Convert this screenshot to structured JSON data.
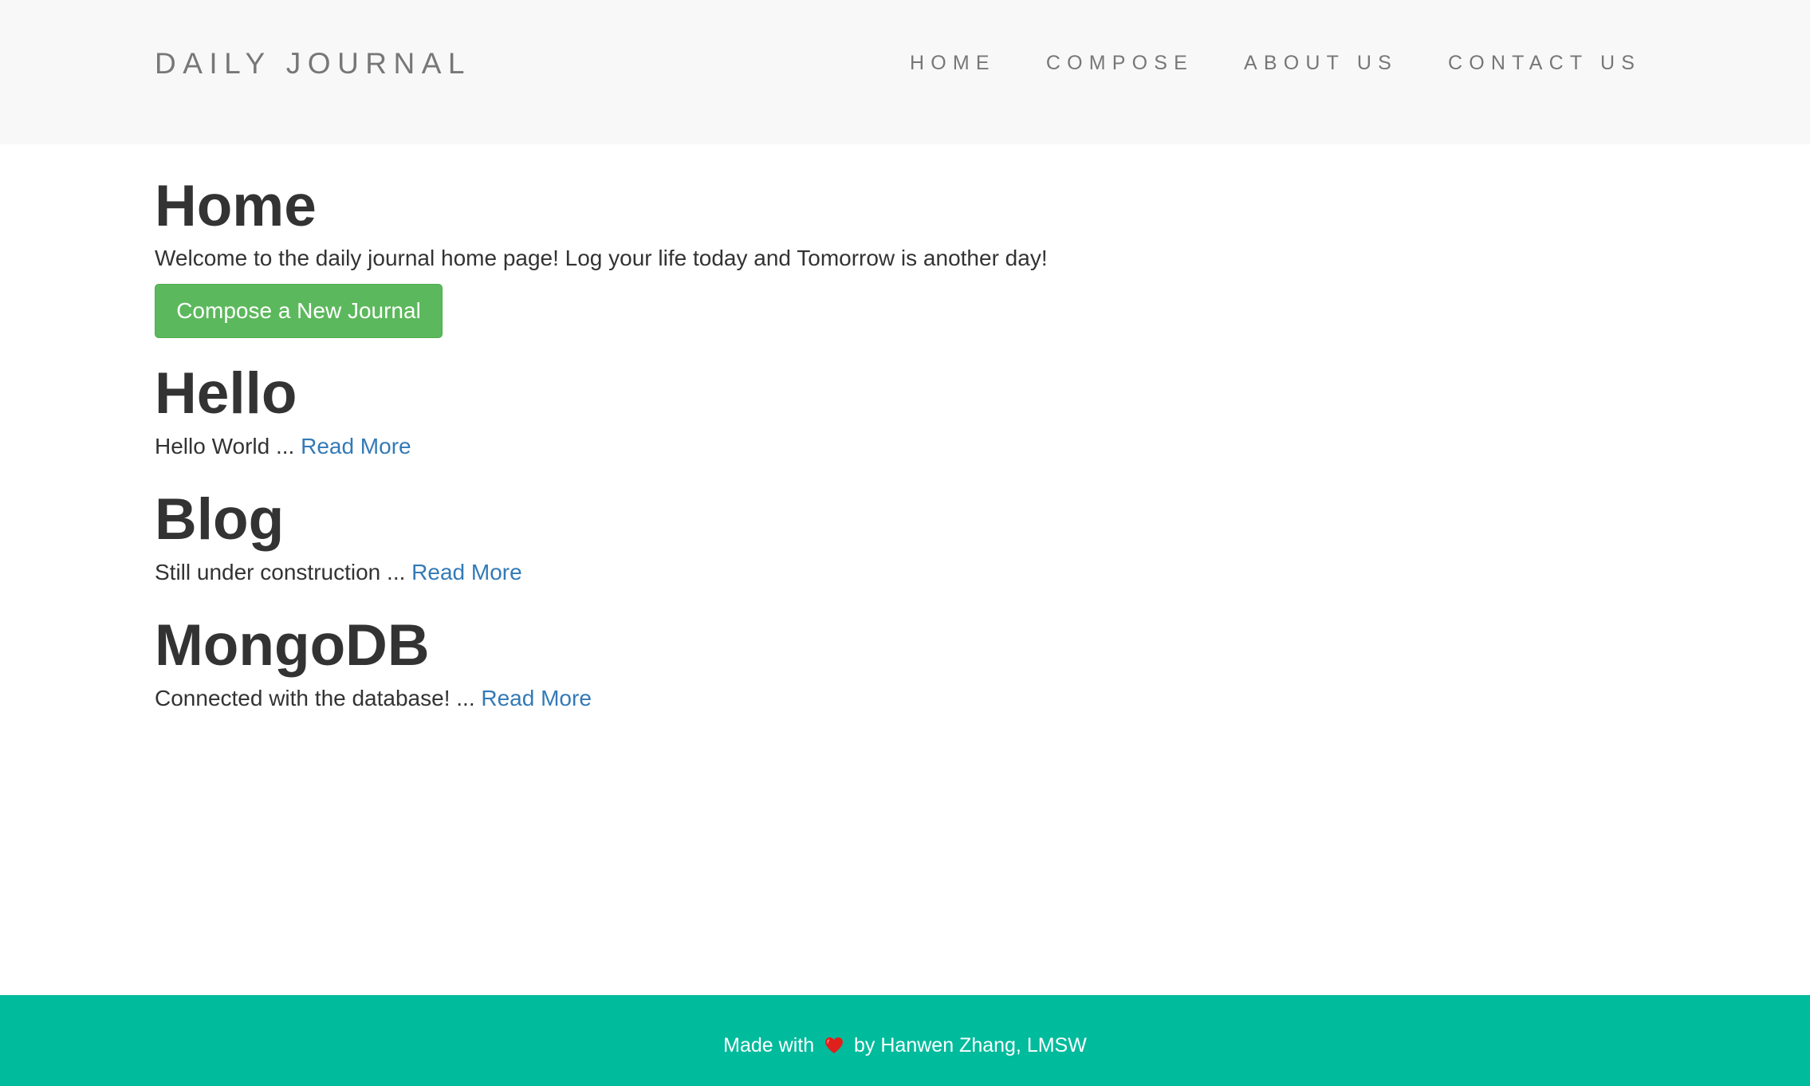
{
  "header": {
    "brand": "DAILY JOURNAL",
    "nav": [
      {
        "label": "HOME"
      },
      {
        "label": "COMPOSE"
      },
      {
        "label": "ABOUT US"
      },
      {
        "label": "CONTACT US"
      }
    ]
  },
  "main": {
    "title": "Home",
    "intro": "Welcome to the daily journal home page! Log your life today and Tomorrow is another day!",
    "compose_button": "Compose a New Journal",
    "posts": [
      {
        "title": "Hello",
        "excerpt": "Hello World ... ",
        "link": "Read More"
      },
      {
        "title": "Blog",
        "excerpt": "Still under construction ... ",
        "link": "Read More"
      },
      {
        "title": "MongoDB",
        "excerpt": "Connected with the database! ... ",
        "link": "Read More"
      }
    ]
  },
  "footer": {
    "made_with": "Made with",
    "icon": "heart-icon",
    "author": "by Hanwen Zhang, LMSW"
  },
  "colors": {
    "navbar_bg": "#f8f8f8",
    "nav_text": "#777777",
    "heading_text": "#333333",
    "link": "#337ab7",
    "button_bg": "#5cb85c",
    "footer_bg": "#00bb9c",
    "heart": "#e0201c"
  }
}
